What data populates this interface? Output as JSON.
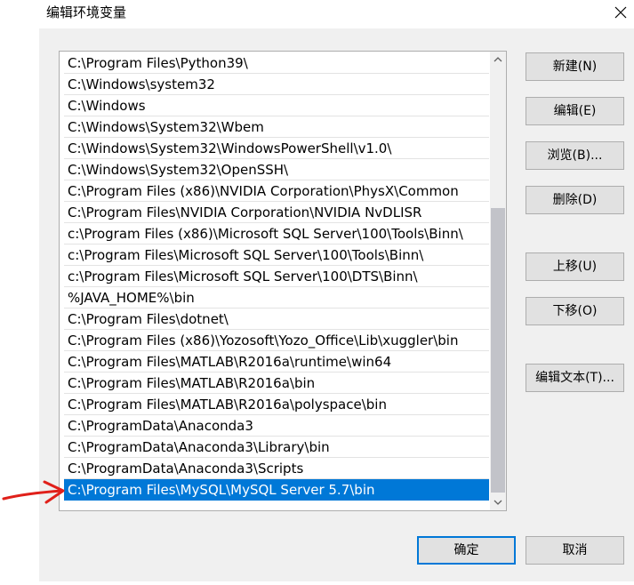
{
  "window": {
    "title": "编辑环境变量",
    "close_icon": "close-icon"
  },
  "list": {
    "selected_index": 20,
    "items": [
      "C:\\Program Files\\Python39\\",
      "C:\\Windows\\system32",
      "C:\\Windows",
      "C:\\Windows\\System32\\Wbem",
      "C:\\Windows\\System32\\WindowsPowerShell\\v1.0\\",
      "C:\\Windows\\System32\\OpenSSH\\",
      "C:\\Program Files (x86)\\NVIDIA Corporation\\PhysX\\Common",
      "C:\\Program Files\\NVIDIA Corporation\\NVIDIA NvDLISR",
      "c:\\Program Files (x86)\\Microsoft SQL Server\\100\\Tools\\Binn\\",
      "c:\\Program Files\\Microsoft SQL Server\\100\\Tools\\Binn\\",
      "c:\\Program Files\\Microsoft SQL Server\\100\\DTS\\Binn\\",
      "%JAVA_HOME%\\bin",
      "C:\\Program Files\\dotnet\\",
      "C:\\Program Files (x86)\\Yozosoft\\Yozo_Office\\Lib\\xuggler\\bin",
      "C:\\Program Files\\MATLAB\\R2016a\\runtime\\win64",
      "C:\\Program Files\\MATLAB\\R2016a\\bin",
      "C:\\Program Files\\MATLAB\\R2016a\\polyspace\\bin",
      "C:\\ProgramData\\Anaconda3",
      "C:\\ProgramData\\Anaconda3\\Library\\bin",
      "C:\\ProgramData\\Anaconda3\\Scripts",
      "C:\\Program Files\\MySQL\\MySQL Server 5.7\\bin"
    ]
  },
  "buttons": {
    "new": "新建(N)",
    "edit": "编辑(E)",
    "browse": "浏览(B)...",
    "delete": "删除(D)",
    "move_up": "上移(U)",
    "move_down": "下移(O)",
    "edit_text": "编辑文本(T)...",
    "ok": "确定",
    "cancel": "取消"
  },
  "colors": {
    "selection": "#0078d7",
    "annotation_arrow": "#e0201a"
  }
}
